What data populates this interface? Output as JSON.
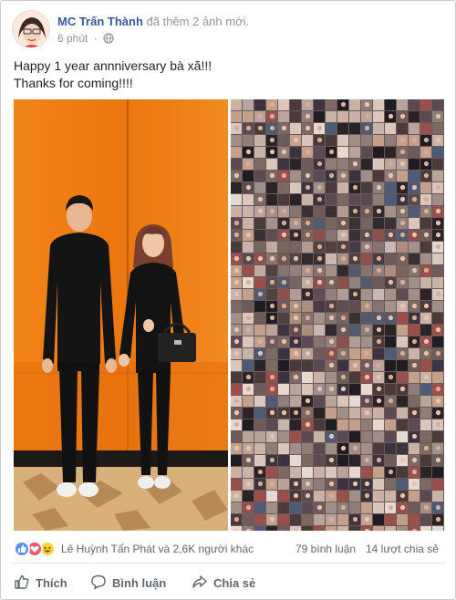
{
  "post": {
    "author_name": "MC Trấn Thành",
    "author_action": "đã thêm 2 ảnh mới.",
    "timestamp": "6 phút",
    "separator": "·",
    "privacy_icon": "globe-icon",
    "text_lines": [
      "Happy 1 year annniversary bà xã!!!",
      "Thanks for coming!!!!"
    ]
  },
  "stats": {
    "reaction_icons": [
      "like-reaction-icon",
      "love-reaction-icon",
      "haha-reaction-icon"
    ],
    "reactors_text": "Lê Huỳnh Tấn Phát và 2,6K người khác",
    "comments_text": "79 bình luận",
    "shares_text": "14 lượt chia sẻ"
  },
  "actions": {
    "like_label": "Thích",
    "comment_label": "Bình luận",
    "share_label": "Chia sẻ"
  },
  "colors": {
    "link_blue": "#365899",
    "muted_gray": "#90949c",
    "like_blue": "#5890ff",
    "love_red": "#f25268",
    "haha_yellow": "#fcd33a",
    "photo_orange": "#ee7a12"
  }
}
